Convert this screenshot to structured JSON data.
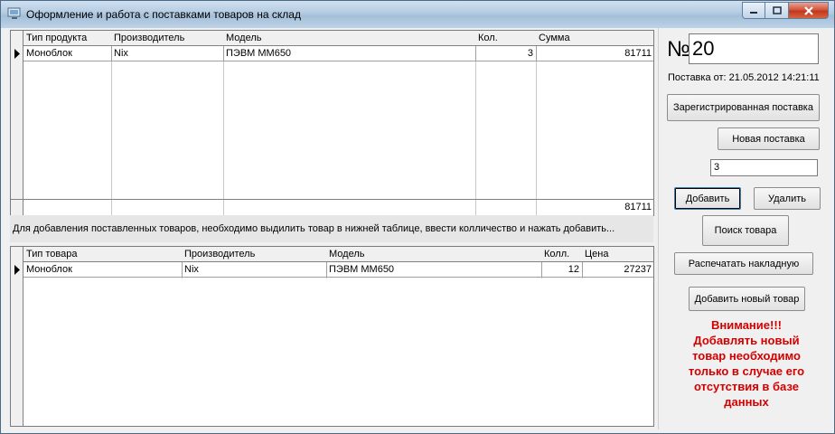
{
  "window": {
    "title": "Оформление и работа с поставками товаров на склад"
  },
  "delivery_grid": {
    "columns": [
      "Тип продукта",
      "Производитель",
      "Модель",
      "Кол.",
      "Сумма"
    ],
    "rows": [
      {
        "type": "Моноблок",
        "maker": "Nix",
        "model": "ПЭВМ MM650",
        "qty": "3",
        "sum": "81711"
      }
    ],
    "footer_total": "81711"
  },
  "info_text": "Для добавления поставленных товаров, необходимо выдилить товар в нижней таблице, ввести колличество и нажать добавить...",
  "goods_grid": {
    "columns": [
      "Тип товара",
      "Производитель",
      "Модель",
      "Колл.",
      "Цена"
    ],
    "rows": [
      {
        "type": "Моноблок",
        "maker": "Nix",
        "model": "ПЭВМ MM650",
        "qty": "12",
        "price": "27237"
      }
    ]
  },
  "panel": {
    "number_sign": "№",
    "number_value": "20",
    "date_label": "Поставка от: 21.05.2012 14:21:11",
    "registered_button": "Зарегистрированная поставка",
    "new_button": "Новая поставка",
    "qty_value": "3",
    "add_button": "Добавить",
    "delete_button": "Удалить",
    "search_button": "Поиск товара",
    "print_button": "Распечатать накладную",
    "add_new_button": "Добавить новый товар",
    "warning": "Внимание!!! Добавлять новый товар необходимо только в случае его отсутствия в базе данных"
  },
  "colors": {
    "warning": "#d40000",
    "close_button": "#c3371c"
  }
}
